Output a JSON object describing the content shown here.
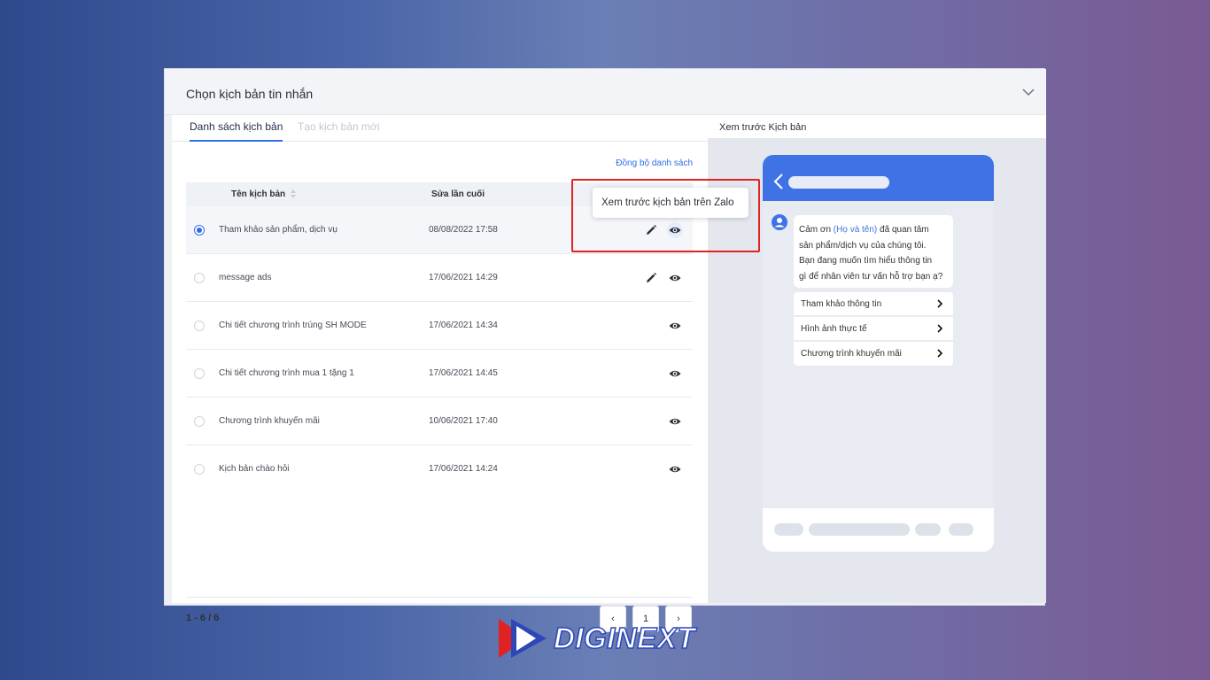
{
  "window": {
    "header_title": "Chọn kịch bản tin nhắn",
    "tabs": {
      "active": "Danh sách kịch bản",
      "inactive": "Tạo kịch bản mới"
    },
    "sync_link": "Đồng bộ danh sách",
    "table": {
      "columns": {
        "name": "Tên kịch bản",
        "modified": "Sửa lần cuối"
      },
      "rows": [
        {
          "name": "Tham khảo sản phẩm, dịch vụ",
          "modified": "08/08/2022 17:58",
          "selected": true,
          "editable": true
        },
        {
          "name": "message ads",
          "modified": "17/06/2021 14:29",
          "selected": false,
          "editable": true
        },
        {
          "name": "Chi tiết chương trình trúng SH MODE",
          "modified": "17/06/2021 14:34",
          "selected": false,
          "editable": false
        },
        {
          "name": "Chi tiết chương trình mua 1 tặng 1",
          "modified": "17/06/2021 14:45",
          "selected": false,
          "editable": false
        },
        {
          "name": "Chương trình khuyến mãi",
          "modified": "10/06/2021 17:40",
          "selected": false,
          "editable": false
        },
        {
          "name": "Kịch bản chào hỏi",
          "modified": "17/06/2021 14:24",
          "selected": false,
          "editable": false
        }
      ]
    },
    "pagination": {
      "range": "1 - 6 / 6",
      "prev": "‹",
      "page": "1",
      "next": "›"
    },
    "tooltip": "Xem trước kịch bản trên Zalo",
    "preview": {
      "title": "Xem trước Kịch bản",
      "message_before": "Cảm ơn ",
      "message_highlight": "(Họ và tên)",
      "message_line1_rest": " đã quan tâm",
      "message_line2": "sản phẩm/dịch vụ của chúng tôi.",
      "message_line3": "Bạn đang muốn tìm hiểu thông tin",
      "message_line4": "gì để nhân viên tư vấn hỗ trợ bạn ạ?",
      "options": [
        "Tham khảo thông tin",
        "Hình ảnh thực tế",
        "Chương trình khuyến mãi"
      ]
    }
  },
  "brand": {
    "name": "DIGINEXT"
  },
  "colors": {
    "accent": "#2f6fe4",
    "phone_header": "#3f73e5",
    "highlight_box": "#e02222"
  },
  "icons": [
    "chevron-down-icon",
    "sort-icon",
    "pencil-icon",
    "eye-icon",
    "back-arrow-icon",
    "avatar-icon",
    "chevron-right-icon"
  ]
}
